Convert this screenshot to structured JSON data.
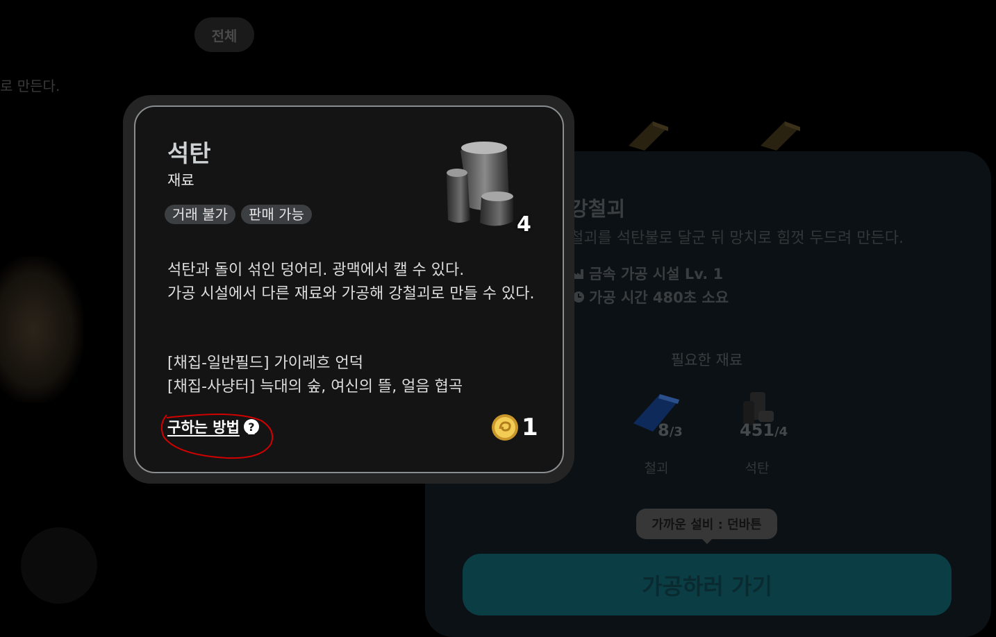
{
  "background": {
    "filter_pill": "전체",
    "left_snippet": "로 만든다.",
    "detail": {
      "title": "강철괴",
      "description": "철괴를 석탄불로 달군 뒤 망치로 힘껏 두드려 만든다.",
      "facility": "금속 가공 시설 Lv. 1",
      "process_time": "가공 시간 480초 소요",
      "facility_icon": "factory-icon",
      "time_icon": "clock-icon"
    },
    "required": {
      "title": "필요한 재료",
      "items": [
        {
          "name": "철괴",
          "have": "8",
          "need": "/3",
          "icon": "iron-bar-icon"
        },
        {
          "name": "석탄",
          "have": "451",
          "need": "/4",
          "icon": "coal-icon"
        }
      ]
    },
    "tooltip": "가까운 설비 : 던바튼",
    "go_button": "가공하러 가기"
  },
  "popup": {
    "name": "석탄",
    "type": "재료",
    "tags": [
      "거래 불가",
      "판매 가능"
    ],
    "quantity": "4",
    "description": [
      "석탄과 돌이 섞인 덩어리. 광맥에서 캘 수 있다.",
      "가공 시설에서 다른 재료와 가공해 강철괴로 만들 수 있다."
    ],
    "sources": [
      "[채집-일반필드] 가이레흐 언덕",
      "[채집-사냥터] 늑대의 숲, 여신의 뜰, 얼음 협곡"
    ],
    "how_to_get": "구하는 방법",
    "price": "1",
    "icons": {
      "help": "help-icon",
      "coin": "gold-coin-icon"
    },
    "colors": {
      "accent_teal": "#0b3d45",
      "annotation_red": "#d40000"
    }
  }
}
